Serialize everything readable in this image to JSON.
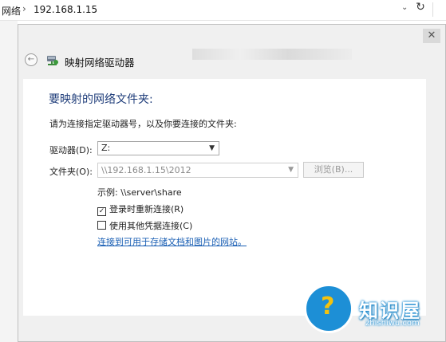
{
  "address_bar": {
    "breadcrumb_partial": "网络",
    "separator": "›",
    "path": "192.168.1.15",
    "dropdown_glyph": "⌄",
    "refresh_glyph": "↻"
  },
  "dialog": {
    "close_glyph": "✕",
    "back_glyph": "←",
    "title": "映射网络驱动器",
    "heading": "要映射的网络文件夹:",
    "instruction": "请为连接指定驱动器号，以及你要连接的文件夹:",
    "drive_label": "驱动器(D):",
    "drive_value": "Z:",
    "folder_label": "文件夹(O):",
    "folder_value": "\\\\192.168.1.15\\2012",
    "browse_label": "浏览(B)...",
    "example_text": "示例: \\\\server\\share",
    "reconnect_label": "登录时重新连接(R)",
    "reconnect_checked": true,
    "other_credentials_label": "使用其他凭据连接(C)",
    "other_credentials_checked": false,
    "link_text": "连接到可用于存储文档和图片的网站。"
  },
  "watermark": {
    "name": "知识屋",
    "url": "zhishiwu.com",
    "symbol": "?"
  },
  "colors": {
    "heading": "#1f3d7a",
    "link": "#1a5fb4",
    "watermark_blue": "#1d8fd6"
  }
}
